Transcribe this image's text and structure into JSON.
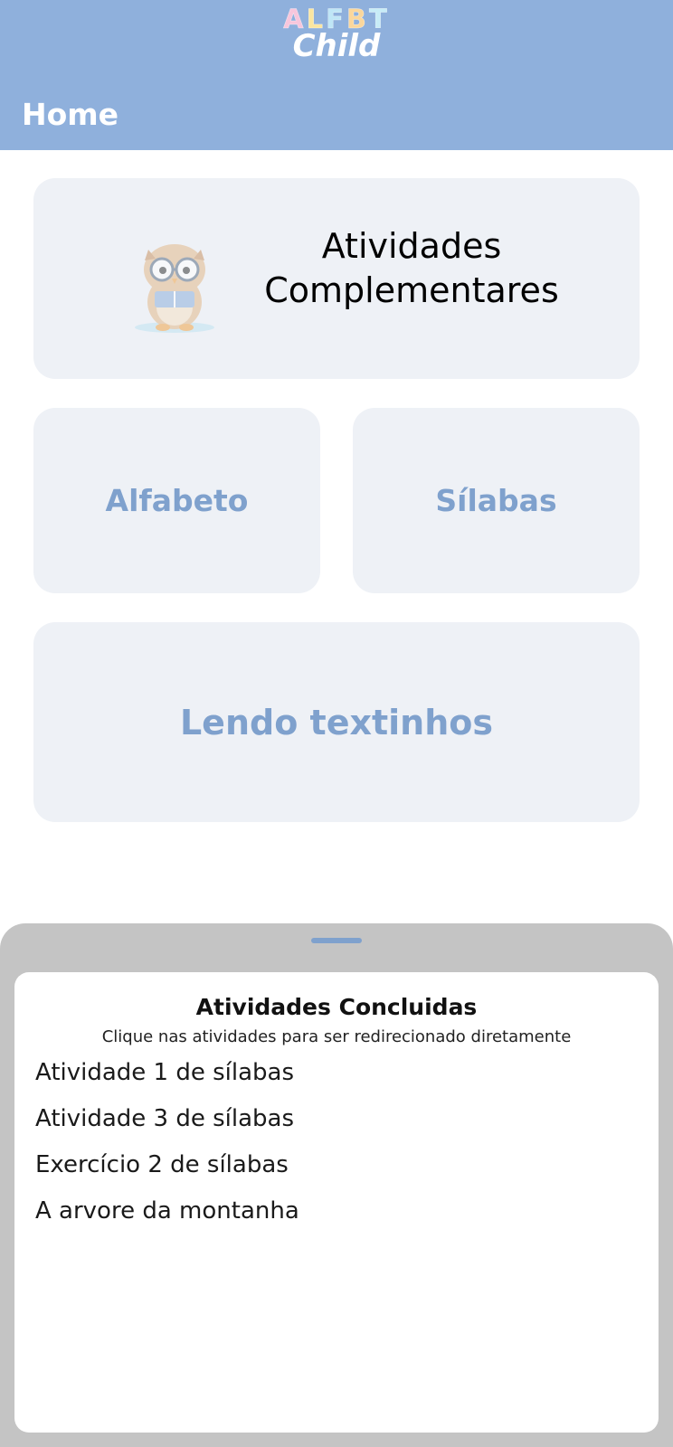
{
  "header": {
    "logo_letters": [
      {
        "char": "A",
        "color": "#f7c6dc"
      },
      {
        "char": "L",
        "color": "#fbe6a0"
      },
      {
        "char": "F",
        "color": "#bfe6f6"
      },
      {
        "char": "B",
        "color": "#fbd79c"
      },
      {
        "char": "T",
        "color": "#c7ecf7"
      }
    ],
    "logo_word": "Child",
    "title": "Home"
  },
  "cards": {
    "complementares": {
      "line1": "Atividades",
      "line2": "Complementares",
      "icon": "owl-reading-icon"
    },
    "alfabeto": "Alfabeto",
    "silabas": "Sílabas",
    "textinhos": "Lendo textinhos"
  },
  "colors": {
    "header_bg": "#8fb0dc",
    "card_bg": "#eef1f6",
    "card_text": "#7fa1cd",
    "sheet_bg": "#c4c4c4"
  },
  "completed": {
    "title": "Atividades Concluidas",
    "subtitle": "Clique nas atividades para ser redirecionado diretamente",
    "items": [
      "Atividade 1 de sílabas",
      "Atividade 3 de sílabas",
      "Exercício 2 de sílabas",
      "A arvore da montanha"
    ]
  }
}
